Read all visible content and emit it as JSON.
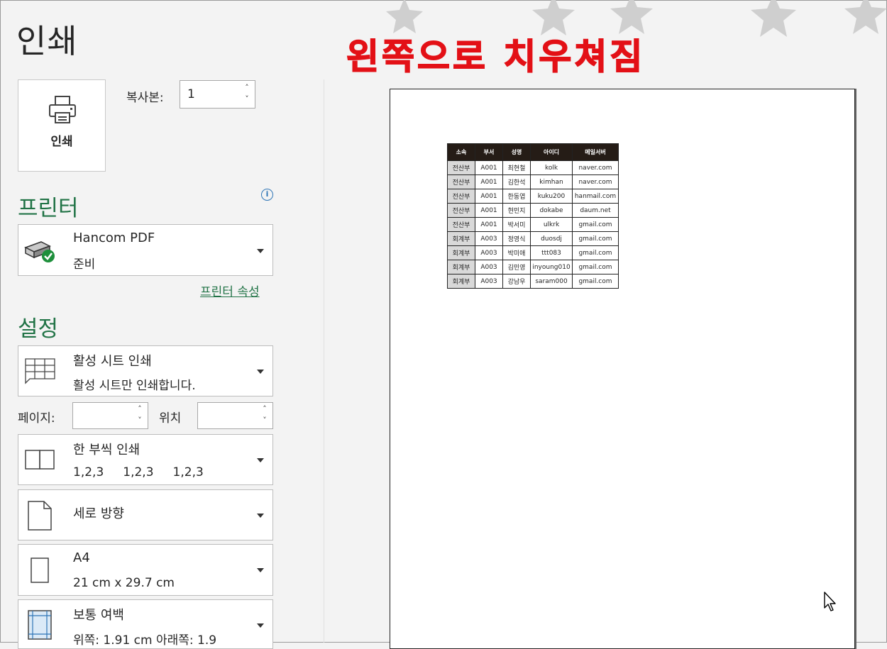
{
  "page_title": "인쇄",
  "annotation": "왼쪽으로 치우쳐짐",
  "print_button": {
    "label": "인쇄"
  },
  "copies": {
    "label": "복사본:",
    "value": "1"
  },
  "printer": {
    "heading": "프린터",
    "name": "Hancom PDF",
    "status": "준비",
    "properties_link": "프린터 속성"
  },
  "settings": {
    "heading": "설정",
    "scope": {
      "title": "활성 시트 인쇄",
      "subtitle": "활성 시트만 인쇄합니다."
    },
    "pages_label": "페이지:",
    "to_label": "위치",
    "collate": {
      "title": "한 부씩 인쇄",
      "subtitle": "1,2,3     1,2,3     1,2,3"
    },
    "orientation": {
      "title": "세로 방향"
    },
    "paper": {
      "title": "A4",
      "subtitle": "21 cm x 29.7 cm"
    },
    "margins": {
      "title": "보통 여백",
      "subtitle": "위쪽: 1.91 cm 아래쪽: 1.9"
    }
  },
  "preview": {
    "headers": [
      "소속",
      "부서",
      "성명",
      "아이디",
      "메일서버"
    ],
    "rows": [
      [
        "전산부",
        "A001",
        "최현철",
        "kolk",
        "naver.com"
      ],
      [
        "전산부",
        "A001",
        "김한석",
        "kimhan",
        "naver.com"
      ],
      [
        "전산부",
        "A001",
        "한동엽",
        "kuku200",
        "hanmail.com"
      ],
      [
        "전산부",
        "A001",
        "현민지",
        "dokabe",
        "daum.net"
      ],
      [
        "전산부",
        "A001",
        "박서미",
        "ulkrk",
        "gmail.com"
      ],
      [
        "회계부",
        "A003",
        "정영식",
        "duosdj",
        "gmail.com"
      ],
      [
        "회계부",
        "A003",
        "박미애",
        "ttt083",
        "gmail.com"
      ],
      [
        "회계부",
        "A003",
        "김민영",
        "inyoung010",
        "gmail.com"
      ],
      [
        "회계부",
        "A003",
        "강남우",
        "saram000",
        "gmail.com"
      ]
    ]
  }
}
